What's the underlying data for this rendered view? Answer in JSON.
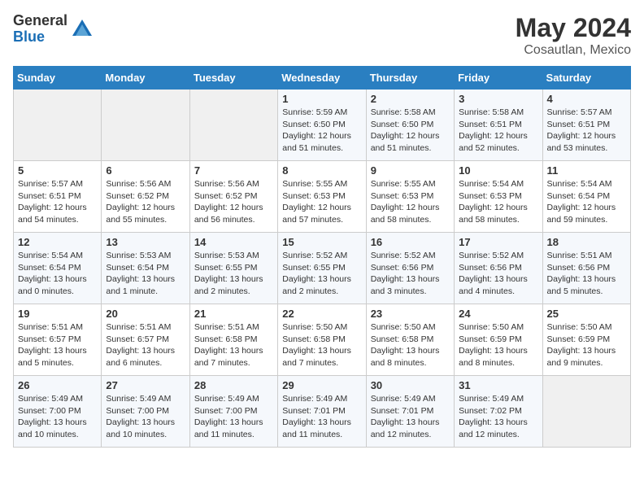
{
  "logo": {
    "general": "General",
    "blue": "Blue"
  },
  "title": "May 2024",
  "location": "Cosautlan, Mexico",
  "days_header": [
    "Sunday",
    "Monday",
    "Tuesday",
    "Wednesday",
    "Thursday",
    "Friday",
    "Saturday"
  ],
  "weeks": [
    [
      {
        "day": "",
        "sunrise": "",
        "sunset": "",
        "daylight": ""
      },
      {
        "day": "",
        "sunrise": "",
        "sunset": "",
        "daylight": ""
      },
      {
        "day": "",
        "sunrise": "",
        "sunset": "",
        "daylight": ""
      },
      {
        "day": "1",
        "sunrise": "5:59 AM",
        "sunset": "6:50 PM",
        "daylight": "12 hours and 51 minutes."
      },
      {
        "day": "2",
        "sunrise": "5:58 AM",
        "sunset": "6:50 PM",
        "daylight": "12 hours and 51 minutes."
      },
      {
        "day": "3",
        "sunrise": "5:58 AM",
        "sunset": "6:51 PM",
        "daylight": "12 hours and 52 minutes."
      },
      {
        "day": "4",
        "sunrise": "5:57 AM",
        "sunset": "6:51 PM",
        "daylight": "12 hours and 53 minutes."
      }
    ],
    [
      {
        "day": "5",
        "sunrise": "5:57 AM",
        "sunset": "6:51 PM",
        "daylight": "12 hours and 54 minutes."
      },
      {
        "day": "6",
        "sunrise": "5:56 AM",
        "sunset": "6:52 PM",
        "daylight": "12 hours and 55 minutes."
      },
      {
        "day": "7",
        "sunrise": "5:56 AM",
        "sunset": "6:52 PM",
        "daylight": "12 hours and 56 minutes."
      },
      {
        "day": "8",
        "sunrise": "5:55 AM",
        "sunset": "6:53 PM",
        "daylight": "12 hours and 57 minutes."
      },
      {
        "day": "9",
        "sunrise": "5:55 AM",
        "sunset": "6:53 PM",
        "daylight": "12 hours and 58 minutes."
      },
      {
        "day": "10",
        "sunrise": "5:54 AM",
        "sunset": "6:53 PM",
        "daylight": "12 hours and 58 minutes."
      },
      {
        "day": "11",
        "sunrise": "5:54 AM",
        "sunset": "6:54 PM",
        "daylight": "12 hours and 59 minutes."
      }
    ],
    [
      {
        "day": "12",
        "sunrise": "5:54 AM",
        "sunset": "6:54 PM",
        "daylight": "13 hours and 0 minutes."
      },
      {
        "day": "13",
        "sunrise": "5:53 AM",
        "sunset": "6:54 PM",
        "daylight": "13 hours and 1 minute."
      },
      {
        "day": "14",
        "sunrise": "5:53 AM",
        "sunset": "6:55 PM",
        "daylight": "13 hours and 2 minutes."
      },
      {
        "day": "15",
        "sunrise": "5:52 AM",
        "sunset": "6:55 PM",
        "daylight": "13 hours and 2 minutes."
      },
      {
        "day": "16",
        "sunrise": "5:52 AM",
        "sunset": "6:56 PM",
        "daylight": "13 hours and 3 minutes."
      },
      {
        "day": "17",
        "sunrise": "5:52 AM",
        "sunset": "6:56 PM",
        "daylight": "13 hours and 4 minutes."
      },
      {
        "day": "18",
        "sunrise": "5:51 AM",
        "sunset": "6:56 PM",
        "daylight": "13 hours and 5 minutes."
      }
    ],
    [
      {
        "day": "19",
        "sunrise": "5:51 AM",
        "sunset": "6:57 PM",
        "daylight": "13 hours and 5 minutes."
      },
      {
        "day": "20",
        "sunrise": "5:51 AM",
        "sunset": "6:57 PM",
        "daylight": "13 hours and 6 minutes."
      },
      {
        "day": "21",
        "sunrise": "5:51 AM",
        "sunset": "6:58 PM",
        "daylight": "13 hours and 7 minutes."
      },
      {
        "day": "22",
        "sunrise": "5:50 AM",
        "sunset": "6:58 PM",
        "daylight": "13 hours and 7 minutes."
      },
      {
        "day": "23",
        "sunrise": "5:50 AM",
        "sunset": "6:58 PM",
        "daylight": "13 hours and 8 minutes."
      },
      {
        "day": "24",
        "sunrise": "5:50 AM",
        "sunset": "6:59 PM",
        "daylight": "13 hours and 8 minutes."
      },
      {
        "day": "25",
        "sunrise": "5:50 AM",
        "sunset": "6:59 PM",
        "daylight": "13 hours and 9 minutes."
      }
    ],
    [
      {
        "day": "26",
        "sunrise": "5:49 AM",
        "sunset": "7:00 PM",
        "daylight": "13 hours and 10 minutes."
      },
      {
        "day": "27",
        "sunrise": "5:49 AM",
        "sunset": "7:00 PM",
        "daylight": "13 hours and 10 minutes."
      },
      {
        "day": "28",
        "sunrise": "5:49 AM",
        "sunset": "7:00 PM",
        "daylight": "13 hours and 11 minutes."
      },
      {
        "day": "29",
        "sunrise": "5:49 AM",
        "sunset": "7:01 PM",
        "daylight": "13 hours and 11 minutes."
      },
      {
        "day": "30",
        "sunrise": "5:49 AM",
        "sunset": "7:01 PM",
        "daylight": "13 hours and 12 minutes."
      },
      {
        "day": "31",
        "sunrise": "5:49 AM",
        "sunset": "7:02 PM",
        "daylight": "13 hours and 12 minutes."
      },
      {
        "day": "",
        "sunrise": "",
        "sunset": "",
        "daylight": ""
      }
    ]
  ]
}
